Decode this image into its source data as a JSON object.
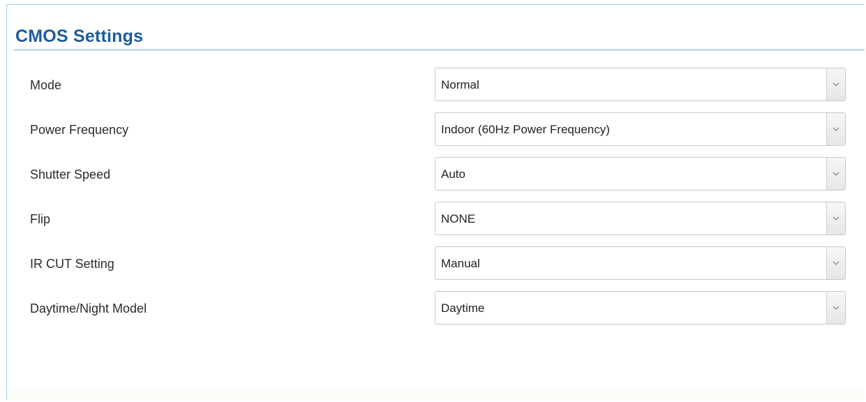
{
  "panel": {
    "title": "CMOS Settings"
  },
  "settings": [
    {
      "label": "Mode",
      "value": "Normal"
    },
    {
      "label": "Power Frequency",
      "value": "Indoor (60Hz Power Frequency)"
    },
    {
      "label": "Shutter Speed",
      "value": "Auto"
    },
    {
      "label": "Flip",
      "value": "NONE"
    },
    {
      "label": "IR CUT Setting",
      "value": "Manual"
    },
    {
      "label": "Daytime/Night Model",
      "value": "Daytime"
    }
  ],
  "icons": {
    "dropdown": "chevron-down-icon"
  },
  "colors": {
    "title": "#1c5d9c",
    "border": "#a9cfee"
  }
}
